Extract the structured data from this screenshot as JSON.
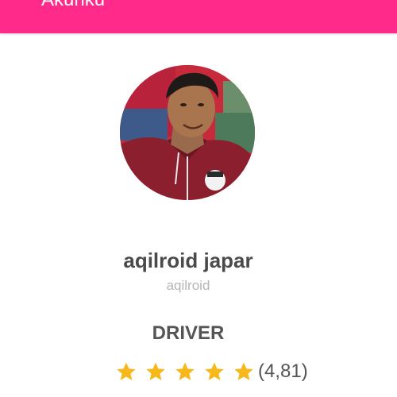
{
  "app_bar": {
    "title": "Akunku",
    "color": "#ff2a8a"
  },
  "profile": {
    "avatar_icon": "user-photo",
    "name": "aqilroid japar",
    "username": "aqilroid",
    "role": "DRIVER"
  },
  "rating": {
    "stars": 5,
    "star_icon": "star-icon",
    "star_color": "#f6b81a",
    "value_label": "(4,81)"
  }
}
